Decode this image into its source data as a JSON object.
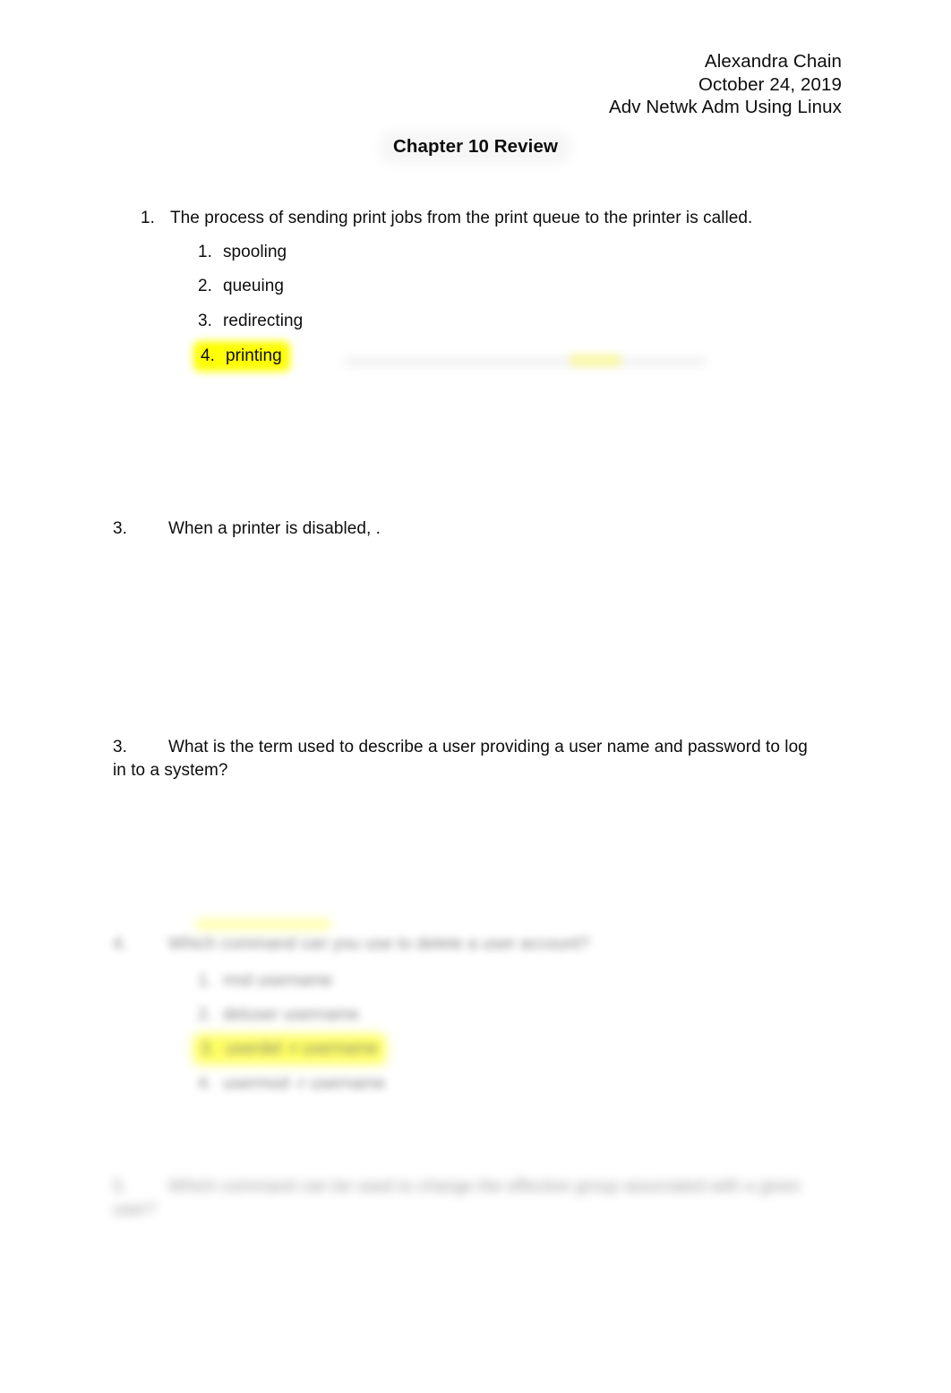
{
  "document": {
    "title": "Chapter 10 Review",
    "header": {
      "author": "Alexandra Chain",
      "date": "October 24, 2019",
      "course": "Adv Netwk Adm Using Linux"
    }
  },
  "questions": [
    {
      "number": "1.",
      "text": "The process of sending print jobs from the print queue to the printer is called.",
      "options": [
        {
          "number": "1.",
          "text": "spooling",
          "highlighted": false
        },
        {
          "number": "2.",
          "text": "queuing",
          "highlighted": false
        },
        {
          "number": "3.",
          "text": "redirecting",
          "highlighted": false
        },
        {
          "number": "4.",
          "text": "printing",
          "highlighted": true
        }
      ]
    },
    {
      "number": "3.",
      "text": "When a printer is disabled, .",
      "options": []
    },
    {
      "number": "3.",
      "text": "What is the term used to describe a user providing a user name and password to log in to a system?",
      "options": []
    }
  ],
  "redacted": {
    "question_4": {
      "number": "4.",
      "text": "Which command can you use to delete a user account?",
      "options": [
        {
          "number": "1.",
          "text": "rmd username",
          "highlighted": false
        },
        {
          "number": "2.",
          "text": "deluser username",
          "highlighted": false
        },
        {
          "number": "3.",
          "text": "userdel -r username",
          "highlighted": true
        },
        {
          "number": "4.",
          "text": "usermod -r username",
          "highlighted": false
        }
      ]
    },
    "question_5": {
      "number": "5.",
      "text": "Which command can be used to change the effective group associated with a given user?",
      "text_line2": "user?"
    }
  },
  "highlight_color": "#ffff00"
}
